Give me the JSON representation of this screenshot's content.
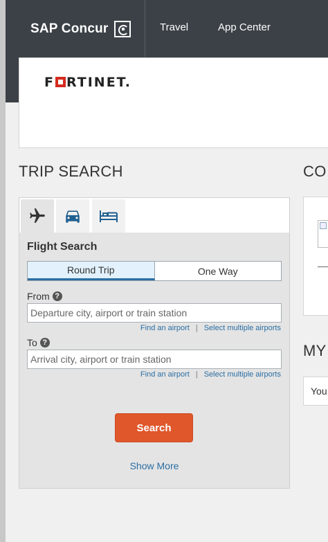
{
  "header": {
    "brand": "SAP Concur",
    "nav": [
      "Travel",
      "App Center"
    ]
  },
  "company": {
    "logo_text_before": "F",
    "logo_text_after": "RTINET."
  },
  "trip_search": {
    "title": "TRIP SEARCH",
    "tabs": [
      {
        "icon": "airplane-icon",
        "label": ""
      },
      {
        "icon": "car-icon",
        "label": ""
      },
      {
        "icon": "bed-icon",
        "label": ""
      }
    ],
    "heading": "Flight Search",
    "trip_types": {
      "round_trip": "Round Trip",
      "one_way": "One Way",
      "selected": "Round Trip"
    },
    "from": {
      "label": "From",
      "placeholder": "Departure city, airport or train station",
      "find_link": "Find an airport",
      "multi_link": "Select multiple airports"
    },
    "to": {
      "label": "To",
      "placeholder": "Arrival city, airport or train station",
      "find_link": "Find an airport",
      "multi_link": "Select multiple airports"
    },
    "separator": "|",
    "help_glyph": "?",
    "search_label": "Search",
    "show_more": "Show More"
  },
  "right_column": {
    "co_title": "CO",
    "my_title": "MY",
    "my_card_text": "You"
  },
  "colors": {
    "topbar": "#3b4147",
    "accent_blue": "#2a6ea3",
    "search_button": "#e0572b",
    "logo_red": "#d52b1e"
  }
}
